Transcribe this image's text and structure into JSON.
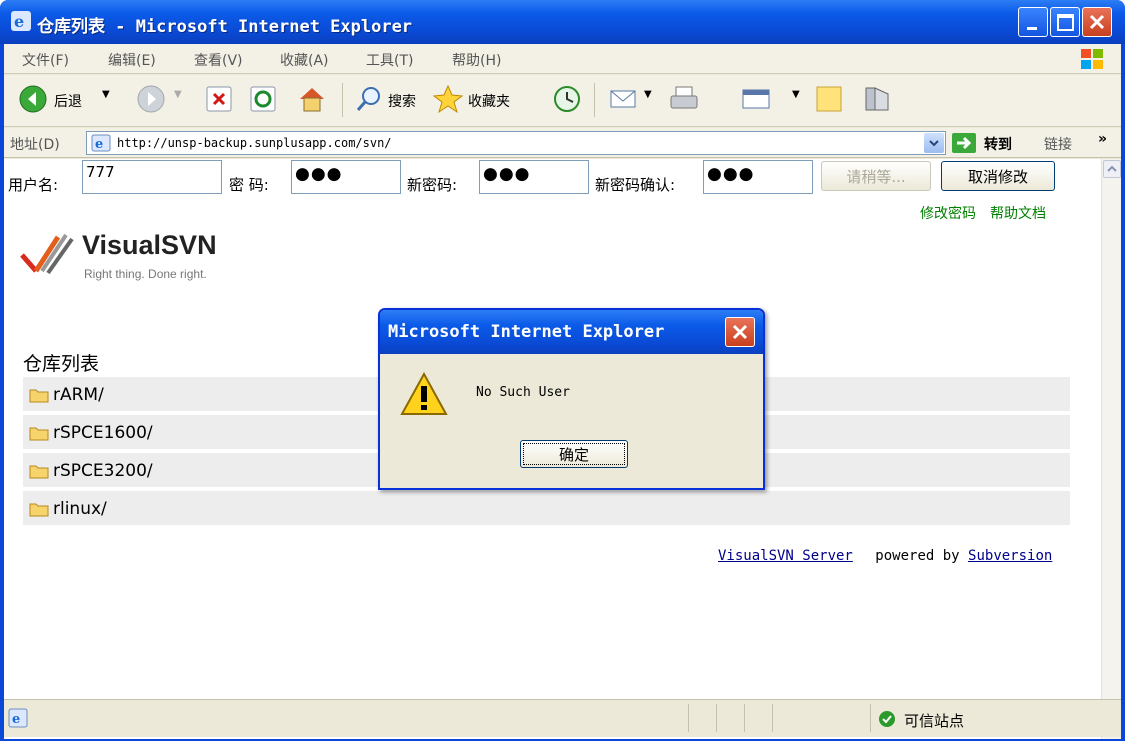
{
  "window": {
    "title": "仓库列表 - Microsoft Internet Explorer"
  },
  "menu": [
    "文件(F)",
    "编辑(E)",
    "查看(V)",
    "收藏(A)",
    "工具(T)",
    "帮助(H)"
  ],
  "toolbar": {
    "back_label": "后退",
    "search_label": "搜索",
    "favorites_label": "收藏夹"
  },
  "address": {
    "label": "地址(D)",
    "url": "http://unsp-backup.sunplusapp.com/svn/",
    "go_label": "转到",
    "links_label": "链接"
  },
  "password_form": {
    "username_label": "用户名:",
    "username_value": "777",
    "password_label": "密 码:",
    "password_mask": "●●●",
    "new_password_label": "新密码:",
    "new_password_mask": "●●●",
    "confirm_label": "新密码确认:",
    "confirm_mask": "●●●",
    "wait_button": "请稍等...",
    "cancel_button": "取消修改",
    "change_link": "修改密码",
    "help_link": "帮助文档"
  },
  "logo": {
    "name": "VisualSVN",
    "tagline": "Right thing. Done right."
  },
  "repo_list": {
    "title": "仓库列表",
    "items": [
      "rARM/",
      "rSPCE1600/",
      "rSPCE3200/",
      "rlinux/"
    ]
  },
  "footer": {
    "server_link": "VisualSVN Server",
    "powered_by": "powered by",
    "subversion_link": "Subversion"
  },
  "status": {
    "zone": "可信站点"
  },
  "dialog": {
    "title": "Microsoft Internet Explorer",
    "message": "No Such User",
    "ok_label": "确定"
  }
}
